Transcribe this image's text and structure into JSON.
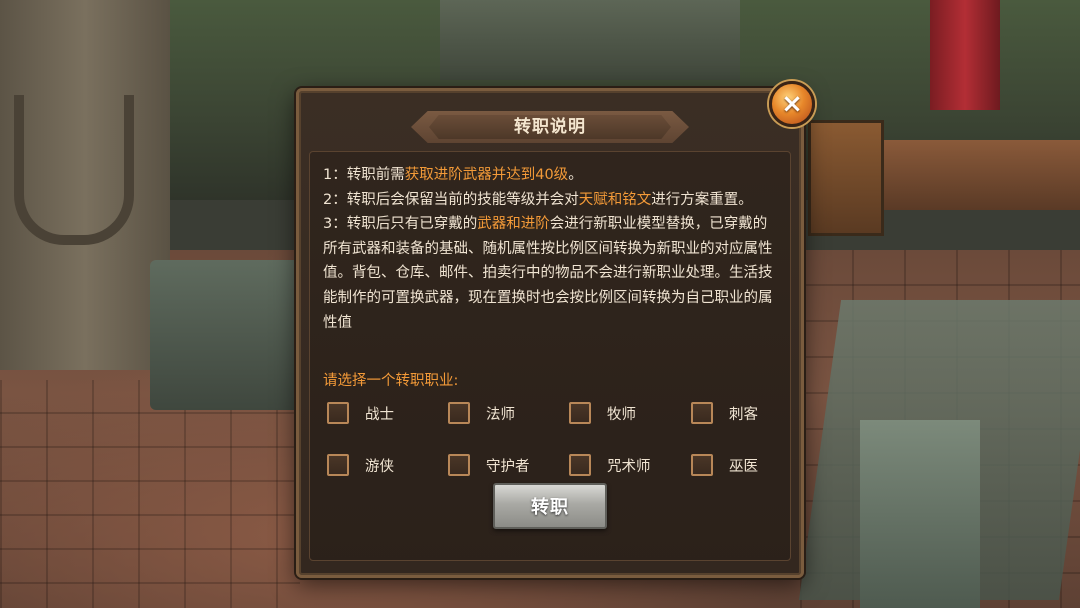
{
  "dialog": {
    "title": "转职说明",
    "close_icon": "×",
    "rules": [
      {
        "segments": [
          {
            "text": "1：转职前需",
            "highlight": false
          },
          {
            "text": "获取进阶武器并达到40级",
            "highlight": true
          },
          {
            "text": "。",
            "highlight": false
          }
        ]
      },
      {
        "segments": [
          {
            "text": "2：转职后会保留当前的技能等级并会对",
            "highlight": false
          },
          {
            "text": "天赋和铭文",
            "highlight": true
          },
          {
            "text": "进行方案重置。",
            "highlight": false
          }
        ]
      },
      {
        "segments": [
          {
            "text": "3：转职后只有已穿戴的",
            "highlight": false
          },
          {
            "text": "武器和进阶",
            "highlight": true
          },
          {
            "text": "会进行新职业模型替换，已穿戴的所有武器和装备的基础、随机属性按比例区间转换为新职业的对应属性值。背包、仓库、邮件、拍卖行中的物品不会进行新职业处理。生活技能制作的可置换武器，现在置换时也会按比例区间转换为自己职业的属性值",
            "highlight": false
          }
        ]
      }
    ],
    "prompt": "请选择一个转职职业:",
    "classes": [
      "战士",
      "法师",
      "牧师",
      "刺客",
      "游侠",
      "守护者",
      "咒术师",
      "巫医"
    ],
    "selected_class": null,
    "confirm_label": "转职"
  },
  "colors": {
    "highlight": "#f39a38",
    "text": "#f0e4d2",
    "panel": "#3b2e24"
  }
}
